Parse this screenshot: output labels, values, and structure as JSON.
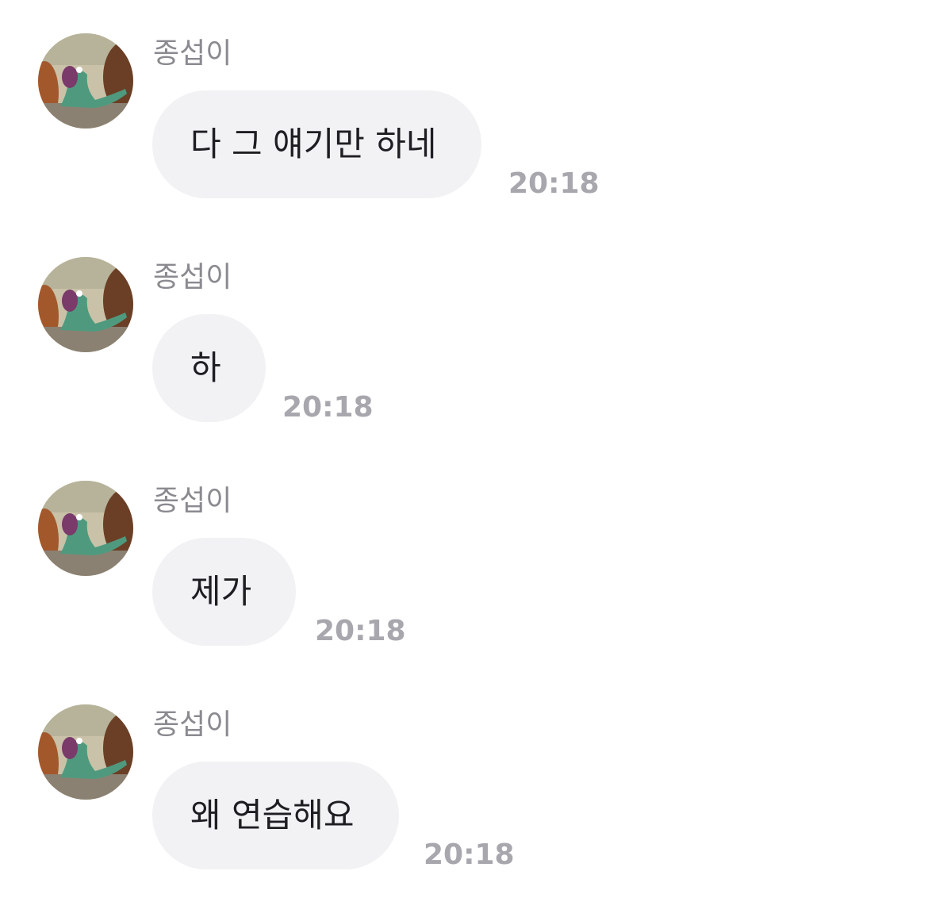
{
  "messages": [
    {
      "sender": "종섭이",
      "text": "다 그 얘기만 하네",
      "time": "20:18"
    },
    {
      "sender": "종섭이",
      "text": "하",
      "time": "20:18"
    },
    {
      "sender": "종섭이",
      "text": "제가",
      "time": "20:18"
    },
    {
      "sender": "종섭이",
      "text": "왜 연습해요",
      "time": "20:18"
    }
  ],
  "colors": {
    "bubble": "#f2f2f5",
    "sender": "#8a8a90",
    "time": "#a7a7ad",
    "text": "#1e1e22"
  },
  "icons": {
    "avatar": "lizard-profile-avatar"
  }
}
